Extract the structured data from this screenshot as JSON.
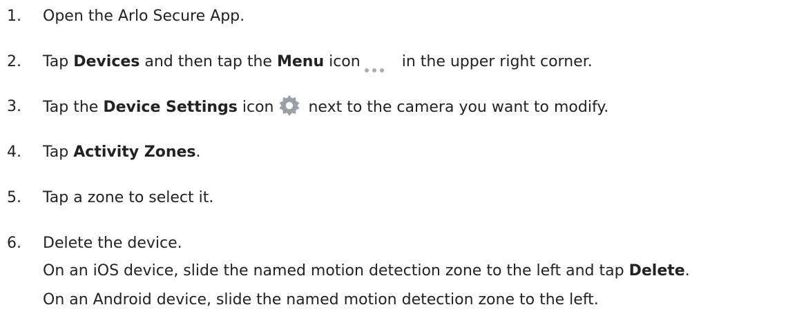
{
  "colors": {
    "text": "#222222",
    "icon_gray": "#9aa0a6",
    "dots_gray": "#a8adb3"
  },
  "steps": [
    {
      "number": "1.",
      "text": "Open the Arlo Secure App."
    },
    {
      "number": "2.",
      "pre": "Tap ",
      "bold1": "Devices",
      "mid": " and then tap the ",
      "bold2": "Menu",
      "post_icon_pre": " icon",
      "icon": "more-horizontal-dots-icon",
      "post": "in the  upper right corner."
    },
    {
      "number": "3.",
      "pre": "Tap the ",
      "bold1": "Device Settings",
      "mid": " icon",
      "icon": "gear-icon",
      "post": "next to the camera you want to modify."
    },
    {
      "number": "4.",
      "pre": "Tap ",
      "bold1": "Activity Zones",
      "post": "."
    },
    {
      "number": "5.",
      "text": "Tap a zone to select it."
    },
    {
      "number": "6.",
      "text": "Delete the device.",
      "sub": [
        {
          "pre": "On an iOS device, slide the named motion detection zone to the left and tap ",
          "bold": "Delete",
          "post": "."
        },
        {
          "text": "On an Android device, slide the named motion detection zone to the left."
        }
      ]
    }
  ]
}
